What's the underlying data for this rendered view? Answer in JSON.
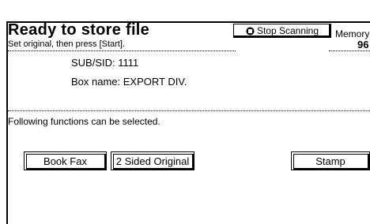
{
  "header": {
    "title": "Ready to store file",
    "subtitle": "Set original, then press [Start].",
    "stop_button_label": "Stop Scanning",
    "memory_label": "Memory",
    "memory_value": "96"
  },
  "info": {
    "sub_sid": "SUB/SID: 1111",
    "box_name": "Box name: EXPORT DIV."
  },
  "functions": {
    "hint": "Following functions can be selected.",
    "buttons": {
      "book_fax": "Book Fax",
      "two_sided": "2 Sided Original",
      "stamp": "Stamp"
    }
  }
}
